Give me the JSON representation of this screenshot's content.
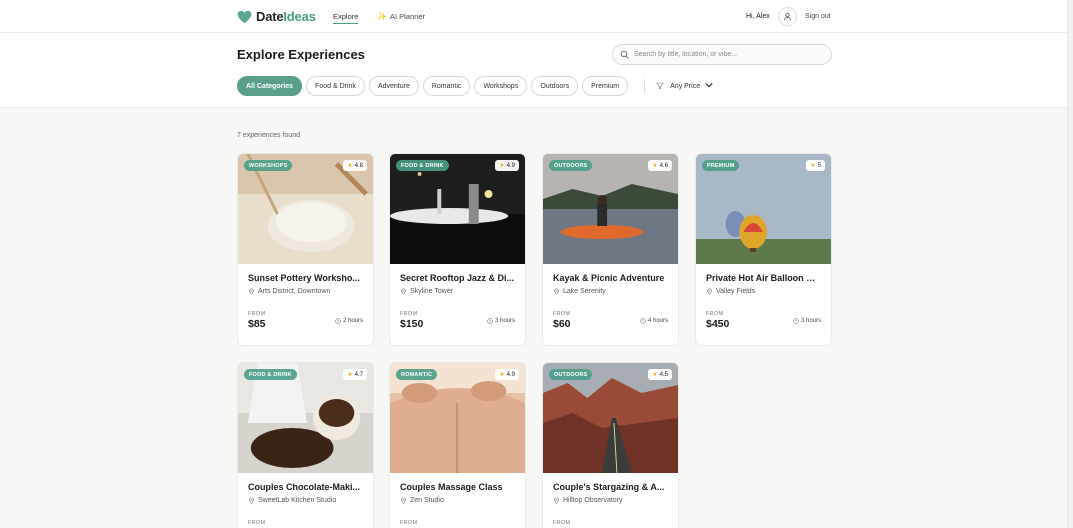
{
  "brand": {
    "name_part1": "Date",
    "name_part2": "Ideas",
    "accent": "#4a9d88"
  },
  "nav": {
    "explore": "Explore",
    "ai_planner": "AI Planner",
    "greeting": "Hi, Alex",
    "sign_out": "Sign out"
  },
  "page": {
    "title": "Explore Experiences",
    "count_text": "7 experiences found"
  },
  "search": {
    "placeholder": "Search by title, location, or vibe..."
  },
  "filters": {
    "categories": [
      "All Categories",
      "Food & Drink",
      "Adventure",
      "Romantic",
      "Workshops",
      "Outdoors",
      "Premium"
    ],
    "active": "All Categories",
    "price_label": "Any Price"
  },
  "cards": [
    {
      "category": "WORKSHOPS",
      "rating": "4.8",
      "title": "Sunset Pottery Worksho...",
      "location": "Arts District, Downtown",
      "from_label": "FROM",
      "price": "$85",
      "duration": "2 hours"
    },
    {
      "category": "FOOD & DRINK",
      "rating": "4.9",
      "title": "Secret Rooftop Jazz & Di...",
      "location": "Skyline Tower",
      "from_label": "FROM",
      "price": "$150",
      "duration": "3 hours"
    },
    {
      "category": "OUTDOORS",
      "rating": "4.6",
      "title": "Kayak & Picnic Adventure",
      "location": "Lake Serenity",
      "from_label": "FROM",
      "price": "$60",
      "duration": "4 hours"
    },
    {
      "category": "PREMIUM",
      "rating": "5",
      "title": "Private Hot Air Balloon Ri...",
      "location": "Valley Fields",
      "from_label": "FROM",
      "price": "$450",
      "duration": "3 hours"
    },
    {
      "category": "FOOD & DRINK",
      "rating": "4.7",
      "title": "Couples Chocolate-Maki...",
      "location": "SweetLab Kitchen Studio",
      "from_label": "FROM"
    },
    {
      "category": "ROMANTIC",
      "rating": "4.9",
      "title": "Couples Massage Class",
      "location": "Zen Studio",
      "from_label": "FROM"
    },
    {
      "category": "OUTDOORS",
      "rating": "4.5",
      "title": "Couple's Stargazing & A...",
      "location": "Hilltop Observatory",
      "from_label": "FROM"
    }
  ]
}
